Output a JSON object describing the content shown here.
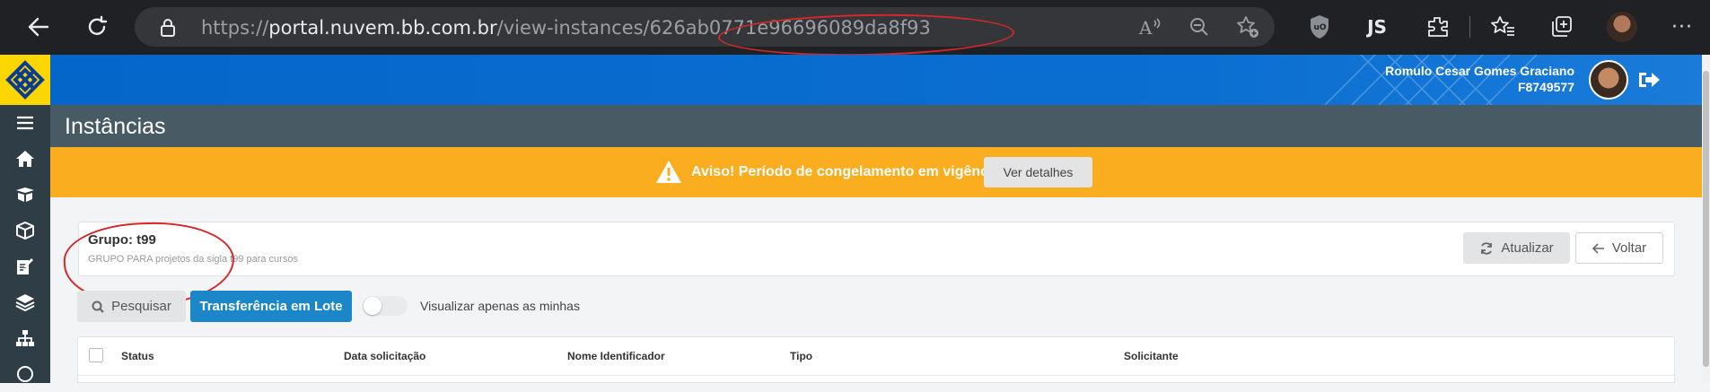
{
  "browser": {
    "url_prefix": "https://",
    "url_host": "portal.nuvem.bb.com.br",
    "url_path": "/view-instances/626ab0771e96696089da8f93",
    "extensions": [
      "read-aloud-icon",
      "zoom-out-icon",
      "favorite-add-icon",
      "ublock-icon",
      "js-icon",
      "extensions-icon",
      "favorites-icon",
      "collections-icon"
    ],
    "js_label": "JS"
  },
  "header": {
    "user_name": "Romulo Cesar Gomes Graciano",
    "user_code": "F8749577"
  },
  "sidebar": {
    "items": [
      "menu-icon",
      "home-icon",
      "box-open-icon",
      "cube-icon",
      "edit-icon",
      "layers-icon",
      "sitemap-icon",
      "circle-icon"
    ]
  },
  "page": {
    "title": "Instâncias"
  },
  "warning": {
    "text": "Aviso! Período de congelamento em vigência",
    "button": "Ver detalhes"
  },
  "group": {
    "title": "Grupo: t99",
    "description": "GRUPO PARA projetos da sigla t99 para cursos"
  },
  "actions": {
    "refresh": "Atualizar",
    "back": "Voltar",
    "search": "Pesquisar",
    "batch_transfer": "Transferência em Lote",
    "toggle_label": "Visualizar apenas as minhas"
  },
  "table": {
    "columns": [
      "Status",
      "Data solicitação",
      "Nome Identificador",
      "Tipo",
      "Solicitante"
    ]
  },
  "colors": {
    "header_blue": "#0b6fd1",
    "logo_yellow": "#fcd600",
    "warning_orange": "#fbad20",
    "primary_button": "#1b87c9",
    "annotation_red": "#d62828"
  }
}
